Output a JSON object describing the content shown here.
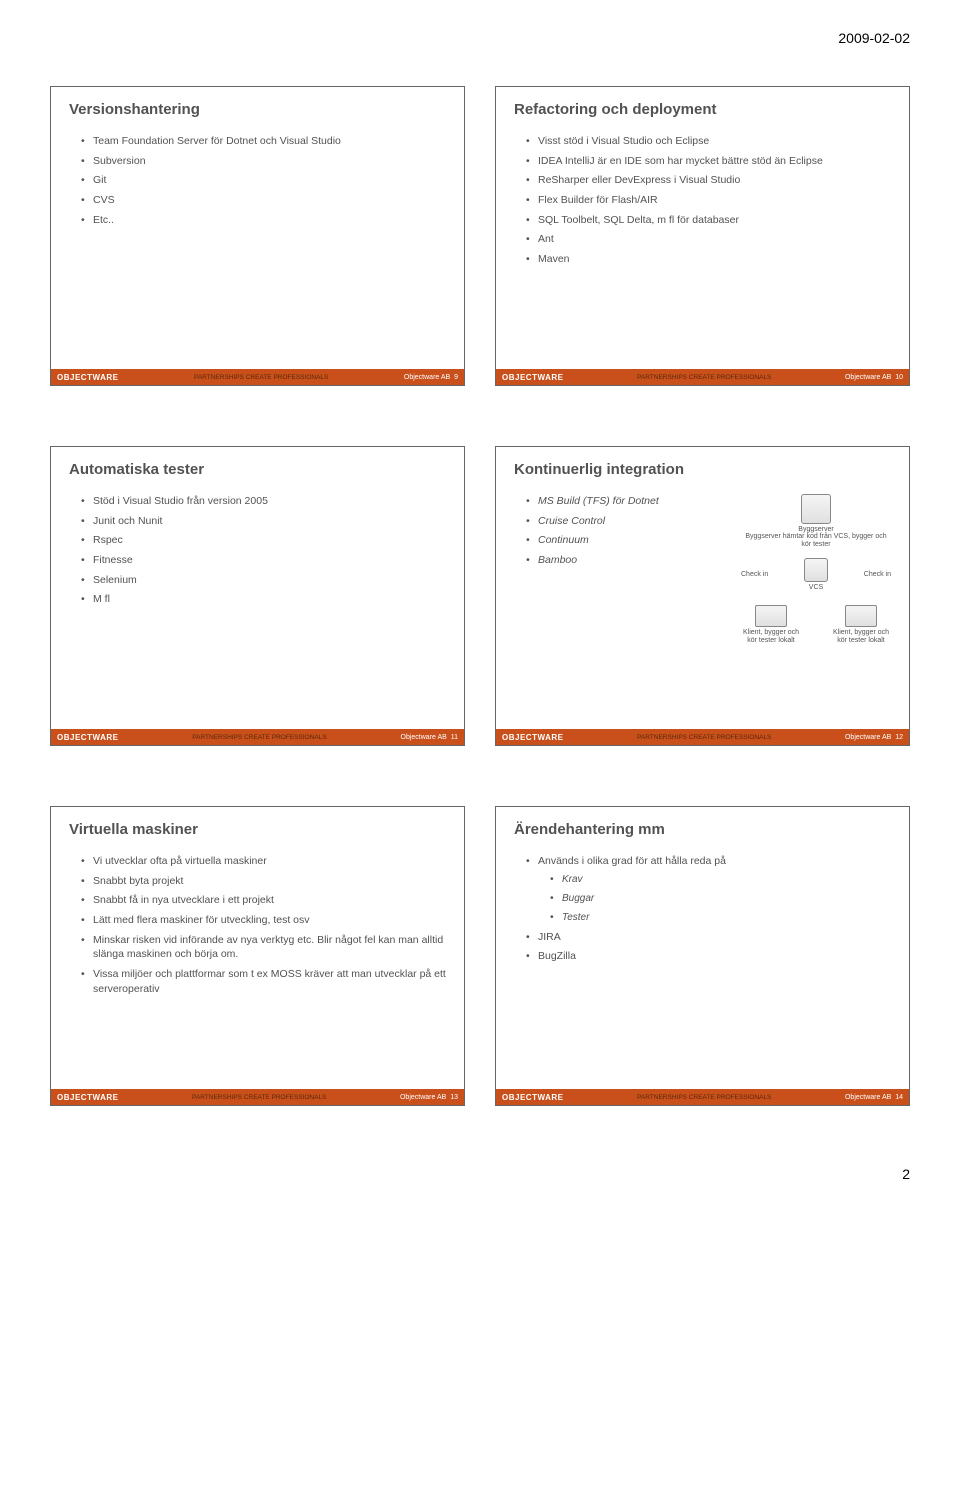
{
  "page_date": "2009-02-02",
  "page_number": "2",
  "footer": {
    "logo_prefix": "OBJECT",
    "logo_suffix": "WARE",
    "company": "Objectware AB",
    "tagline": "PARTNERSHIPS CREATE PROFESSIONALS"
  },
  "slides": [
    {
      "num": "9",
      "title": "Versionshantering",
      "items": [
        "Team Foundation Server för Dotnet och Visual Studio",
        "Subversion",
        "Git",
        "CVS",
        "Etc.."
      ]
    },
    {
      "num": "10",
      "title": "Refactoring  och deployment",
      "items": [
        "Visst stöd i Visual Studio och Eclipse",
        "IDEA IntelliJ är en IDE som har mycket bättre stöd än Eclipse",
        "ReSharper eller DevExpress i Visual Studio",
        "Flex Builder för Flash/AIR",
        "SQL Toolbelt, SQL Delta, m fl för databaser",
        "Ant",
        "Maven"
      ]
    },
    {
      "num": "11",
      "title": "Automatiska tester",
      "items": [
        "Stöd i Visual Studio från version 2005",
        "Junit och Nunit",
        "Rspec",
        "Fitnesse",
        "Selenium",
        "M fl"
      ]
    },
    {
      "num": "12",
      "title": "Kontinuerlig integration",
      "items": [
        "MS Build (TFS) för Dotnet",
        "Cruise Control",
        "Continuum",
        "Bamboo"
      ],
      "diagram": {
        "byggserver": "Byggserver",
        "byggserver_sub": "Byggserver hämtar kod från VCS, bygger och kör tester",
        "checkin": "Check in",
        "vcs": "VCS",
        "klient": "Klient, bygger och kör tester lokalt"
      }
    },
    {
      "num": "13",
      "title": "Virtuella maskiner",
      "items": [
        "Vi utvecklar ofta på virtuella maskiner",
        "Snabbt byta projekt",
        "Snabbt få in nya utvecklare i ett projekt",
        "Lätt med flera maskiner för utveckling, test osv",
        "Minskar risken vid införande av nya verktyg etc. Blir något fel kan man alltid slänga maskinen och börja om.",
        "Vissa miljöer och plattformar som t ex MOSS kräver att man utvecklar på ett serveroperativ"
      ]
    },
    {
      "num": "14",
      "title": "Ärendehantering mm",
      "items": [
        "Används i olika grad för att hålla reda på"
      ],
      "subitems": [
        "Krav",
        "Buggar",
        "Tester"
      ],
      "items2": [
        "JIRA",
        "BugZilla"
      ]
    }
  ]
}
